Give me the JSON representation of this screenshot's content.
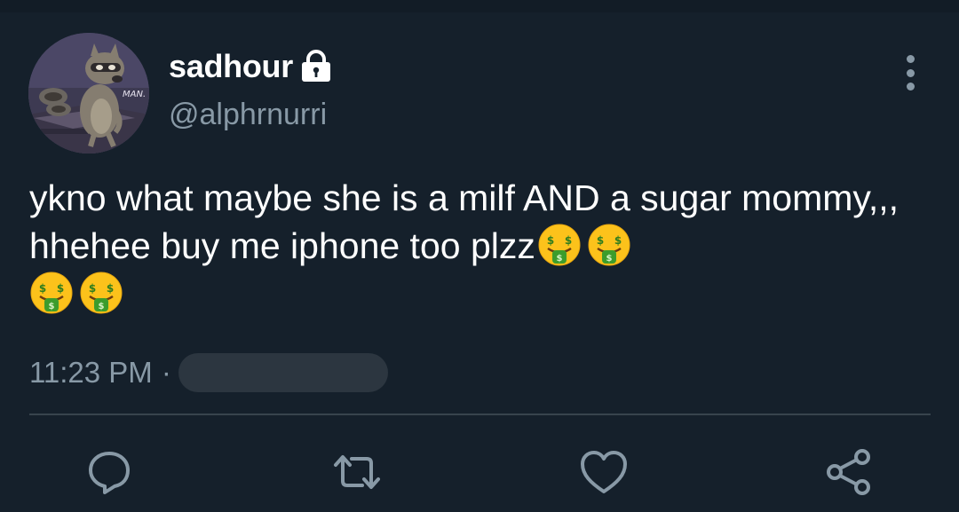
{
  "tweet": {
    "display_name": "sadhour",
    "handle": "@alphrnurri",
    "text": "ykno what maybe she is a milf AND a sugar mommy,,, hhehee buy me iphone too plzz",
    "emoji_count": 4,
    "emoji_name": "money-mouth-face",
    "time": "11:23 PM",
    "separator": "·",
    "protected": true
  },
  "avatar": {
    "caption": "MAN."
  },
  "icons": {
    "lock": "lock-icon",
    "more": "more-vertical-icon",
    "reply": "reply-icon",
    "retweet": "retweet-icon",
    "like": "heart-icon",
    "share": "share-icon"
  },
  "colors": {
    "background": "#15202b",
    "primary_text": "#ffffff",
    "secondary_text": "#8899a6",
    "divider": "#38444d"
  }
}
